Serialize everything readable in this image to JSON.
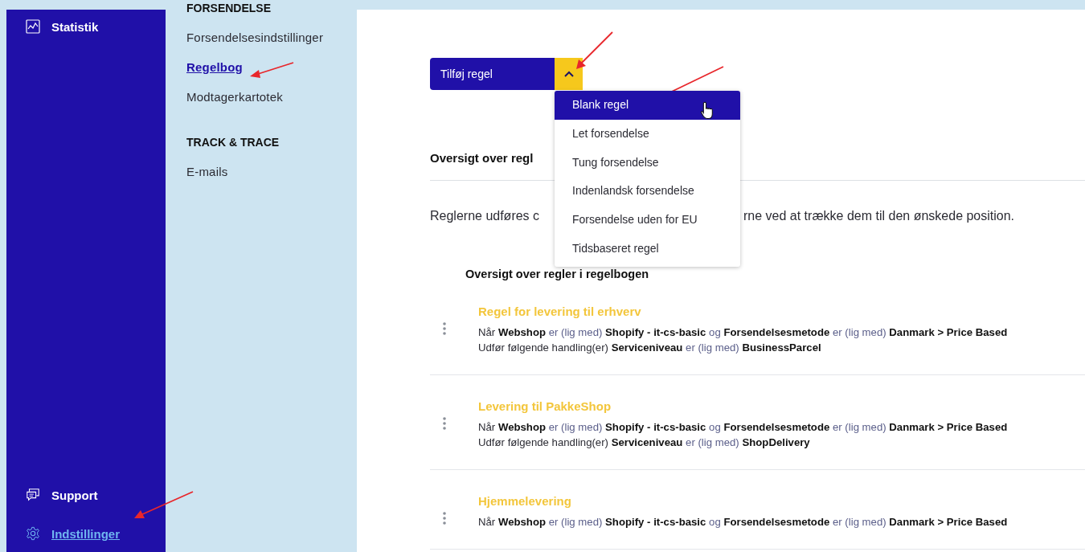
{
  "nav": {
    "top_items": [
      {
        "label": "Statistik",
        "kind": "chart",
        "selected": false
      }
    ],
    "bottom_items": [
      {
        "label": "Support",
        "kind": "chat",
        "selected": false
      },
      {
        "label": "Indstillinger",
        "kind": "gear",
        "selected": true
      }
    ]
  },
  "subnav": {
    "sections": [
      {
        "heading": "FORSENDELSE",
        "items": [
          {
            "label": "Forsendelsesindstillinger",
            "selected": false
          },
          {
            "label": "Regelbog",
            "selected": true
          },
          {
            "label": "Modtagerkartotek",
            "selected": false
          }
        ]
      },
      {
        "heading": "TRACK & TRACE",
        "items": [
          {
            "label": "E-mails",
            "selected": false
          }
        ]
      }
    ]
  },
  "toolbar": {
    "add_button": "Tilføj regel",
    "menu_expanded": true,
    "menu": [
      {
        "label": "Blank regel",
        "selected": true
      },
      {
        "label": "Let forsendelse",
        "selected": false
      },
      {
        "label": "Tung forsendelse",
        "selected": false
      },
      {
        "label": "Indenlandsk forsendelse",
        "selected": false
      },
      {
        "label": "Forsendelse uden for EU",
        "selected": false
      },
      {
        "label": "Tidsbaseret regel",
        "selected": false
      }
    ]
  },
  "section_title": "Oversigt over regl",
  "intro": [
    "Reglerne udføres c",
    "rne ved at trække dem til den ønskede position."
  ],
  "list_title": "Oversigt over regler i regelbogen",
  "rules": [
    {
      "title": "Regel for levering til erhverv",
      "lines": [
        [
          {
            "kind": "text",
            "text": "Når"
          },
          {
            "kind": "value",
            "text": "Webshop"
          },
          {
            "kind": "operator",
            "text": "er (lig med)"
          },
          {
            "kind": "value",
            "text": "Shopify - it-cs-basic"
          },
          {
            "kind": "operator",
            "text": "og"
          },
          {
            "kind": "value",
            "text": "Forsendelsesmetode"
          },
          {
            "kind": "operator",
            "text": "er (lig med)"
          },
          {
            "kind": "value",
            "text": "Danmark > Price Based"
          }
        ],
        [
          {
            "kind": "text",
            "text": "Udfør følgende handling(er)"
          },
          {
            "kind": "value",
            "text": "Serviceniveau"
          },
          {
            "kind": "operator",
            "text": "er (lig med)"
          },
          {
            "kind": "value",
            "text": "BusinessParcel"
          }
        ]
      ]
    },
    {
      "title": "Levering til PakkeShop",
      "lines": [
        [
          {
            "kind": "text",
            "text": "Når"
          },
          {
            "kind": "value",
            "text": "Webshop"
          },
          {
            "kind": "operator",
            "text": "er (lig med)"
          },
          {
            "kind": "value",
            "text": "Shopify - it-cs-basic"
          },
          {
            "kind": "operator",
            "text": "og"
          },
          {
            "kind": "value",
            "text": "Forsendelsesmetode"
          },
          {
            "kind": "operator",
            "text": "er (lig med)"
          },
          {
            "kind": "value",
            "text": "Danmark > Price Based"
          }
        ],
        [
          {
            "kind": "text",
            "text": "Udfør følgende handling(er)"
          },
          {
            "kind": "value",
            "text": "Serviceniveau"
          },
          {
            "kind": "operator",
            "text": "er (lig med)"
          },
          {
            "kind": "value",
            "text": "ShopDelivery"
          }
        ]
      ]
    },
    {
      "title": "Hjemmelevering",
      "lines": [
        [
          {
            "kind": "text",
            "text": "Når"
          },
          {
            "kind": "value",
            "text": "Webshop"
          },
          {
            "kind": "operator",
            "text": "er (lig med)"
          },
          {
            "kind": "value",
            "text": "Shopify - it-cs-basic"
          },
          {
            "kind": "operator",
            "text": "og"
          },
          {
            "kind": "value",
            "text": "Forsendelsesmetode"
          },
          {
            "kind": "operator",
            "text": "er (lig med)"
          },
          {
            "kind": "value",
            "text": "Danmark > Price Based"
          }
        ]
      ]
    }
  ]
}
